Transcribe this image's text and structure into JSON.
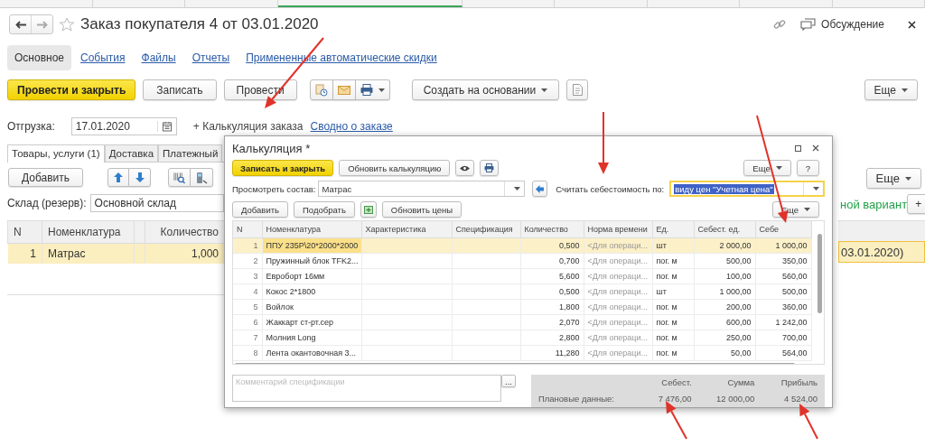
{
  "header": {
    "title": "Заказ покупателя 4 от 03.01.2020",
    "discussion": "Обсуждение"
  },
  "form_tabs": [
    {
      "label": "Основное",
      "selected": true
    },
    {
      "label": "События",
      "selected": false
    },
    {
      "label": "Файлы",
      "selected": false
    },
    {
      "label": "Отчеты",
      "selected": false
    },
    {
      "label": "Примененные автоматические скидки",
      "selected": false
    }
  ],
  "toolbar": {
    "post_close": "Провести и закрыть",
    "save": "Записать",
    "post": "Провести",
    "create_based": "Создать на основании",
    "more": "Еще"
  },
  "shipment": {
    "label": "Отгрузка:",
    "date": "17.01.2020",
    "calc_link": "+ Калькуляция заказа",
    "summary_link": "Сводно о заказе"
  },
  "doc_tabs": [
    {
      "label": "Товары, услуги (1)",
      "selected": true
    },
    {
      "label": "Доставка",
      "selected": false
    },
    {
      "label": "Платежный",
      "selected": false
    }
  ],
  "goods": {
    "add": "Добавить",
    "warehouse_label": "Склад (резерв):",
    "warehouse": "Основной склад",
    "columns": [
      "N",
      "Номенклатура",
      "Количество"
    ],
    "rows": [
      {
        "n": "1",
        "item": "Матрас",
        "qty": "1,000",
        "selected": true
      }
    ],
    "more": "Еще",
    "variant": "ной вариант",
    "add_variant": "+",
    "right_cell": "03.01.2020)"
  },
  "dialog": {
    "title": "Калькуляция *",
    "save_close": "Записать и закрыть",
    "refresh": "Обновить калькуляцию",
    "more": "Еще",
    "help": "?",
    "view_label": "Просмотреть состав:",
    "view_value": "Матрас",
    "cost_label": "Считать себестоимость по:",
    "cost_value": "виду цен \"Учетная цена\"",
    "add": "Добавить",
    "pick": "Подобрать",
    "update_prices": "Обновить цены",
    "table_more": "Еще",
    "columns": [
      "N",
      "Номенклатура",
      "Характеристика",
      "Спецификация",
      "Количество",
      "Норма времени",
      "Ед.",
      "Себест. ед.",
      "Себе"
    ],
    "rows": [
      {
        "n": "1",
        "item": "ППУ 235Р\\20*2000*2000",
        "qty": "0,500",
        "norm": "<Для операци...",
        "unit": "шт",
        "unit_cost": "2 000,00",
        "cost": "1 000,00",
        "selected": true
      },
      {
        "n": "2",
        "item": "Пружинный блок TFK2...",
        "qty": "0,700",
        "norm": "<Для операци...",
        "unit": "пог. м",
        "unit_cost": "500,00",
        "cost": "350,00",
        "selected": false
      },
      {
        "n": "3",
        "item": "Евроборт 16мм",
        "qty": "5,600",
        "norm": "<Для операци...",
        "unit": "пог. м",
        "unit_cost": "100,00",
        "cost": "560,00",
        "selected": false
      },
      {
        "n": "4",
        "item": "Кокос 2*1800",
        "qty": "0,500",
        "norm": "<Для операци...",
        "unit": "шт",
        "unit_cost": "1 000,00",
        "cost": "500,00",
        "selected": false
      },
      {
        "n": "5",
        "item": "Войлок",
        "qty": "1,800",
        "norm": "<Для операци...",
        "unit": "пог. м",
        "unit_cost": "200,00",
        "cost": "360,00",
        "selected": false
      },
      {
        "n": "6",
        "item": "Жаккарт ст-рт.сер",
        "qty": "2,070",
        "norm": "<Для операци...",
        "unit": "пог. м",
        "unit_cost": "600,00",
        "cost": "1 242,00",
        "selected": false
      },
      {
        "n": "7",
        "item": "Молния Long",
        "qty": "2,800",
        "norm": "<Для операци...",
        "unit": "пог. м",
        "unit_cost": "250,00",
        "cost": "700,00",
        "selected": false
      },
      {
        "n": "8",
        "item": "Лента окантовочная 3...",
        "qty": "11,280",
        "norm": "<Для операци...",
        "unit": "пог. м",
        "unit_cost": "50,00",
        "cost": "564,00",
        "selected": false
      }
    ],
    "comment_placeholder": "Комментарий спецификации",
    "comment_button": "...",
    "summary": {
      "headers": [
        "Себест.",
        "Сумма",
        "Прибыль"
      ],
      "label": "Плановые данные:",
      "values": [
        "7 476,00",
        "12 000,00",
        "4 524,00"
      ]
    }
  }
}
